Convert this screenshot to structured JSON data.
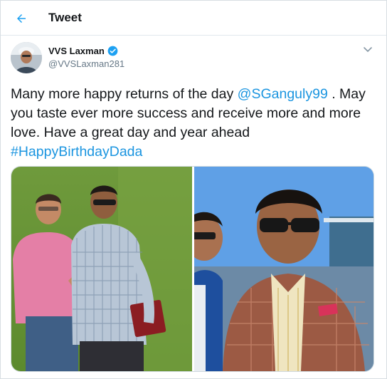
{
  "header": {
    "title": "Tweet",
    "back_icon": "arrow-left-icon"
  },
  "tweet": {
    "author": {
      "display_name": "VVS Laxman",
      "handle": "@VVSLaxman281",
      "verified": true
    },
    "text": {
      "part1": "Many more happy returns of the day ",
      "mention": "@SGanguly99",
      "part2": " . May you taste ever more success and receive more and more love. Have a great day and year ahead ",
      "hashtag": "#HappyBirthdayDada"
    },
    "media": {
      "count": 2
    }
  },
  "colors": {
    "accent": "#1da1f2",
    "link": "#1b95e0",
    "secondary_text": "#657786",
    "divider": "#e1e8ed"
  },
  "icons": {
    "verified": "verified-badge-icon",
    "more": "chevron-down-icon"
  }
}
